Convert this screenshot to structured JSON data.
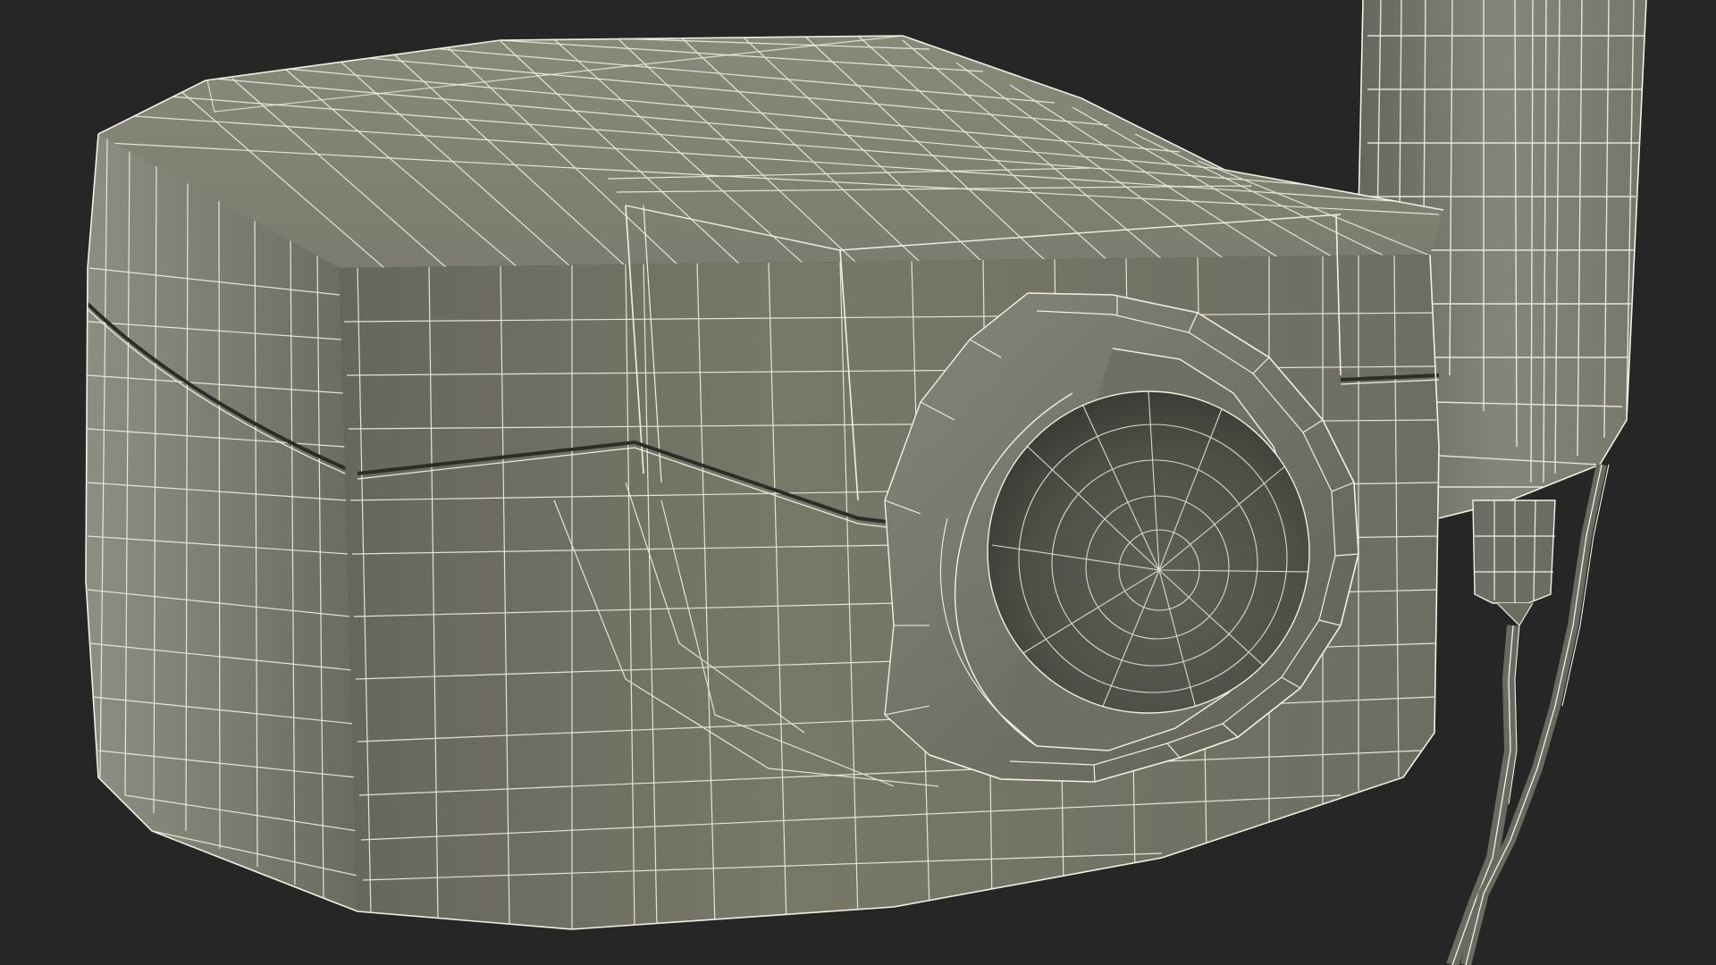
{
  "scene": {
    "subject": "",
    "colors": {
      "background": "#262626",
      "body_light": "#8a8b7e",
      "body_mid": "#76776a",
      "body_dark": "#5a5b50",
      "wire": "#f1f1e4",
      "crease": "#2c2c28",
      "cavity": "#4d4e45"
    }
  }
}
